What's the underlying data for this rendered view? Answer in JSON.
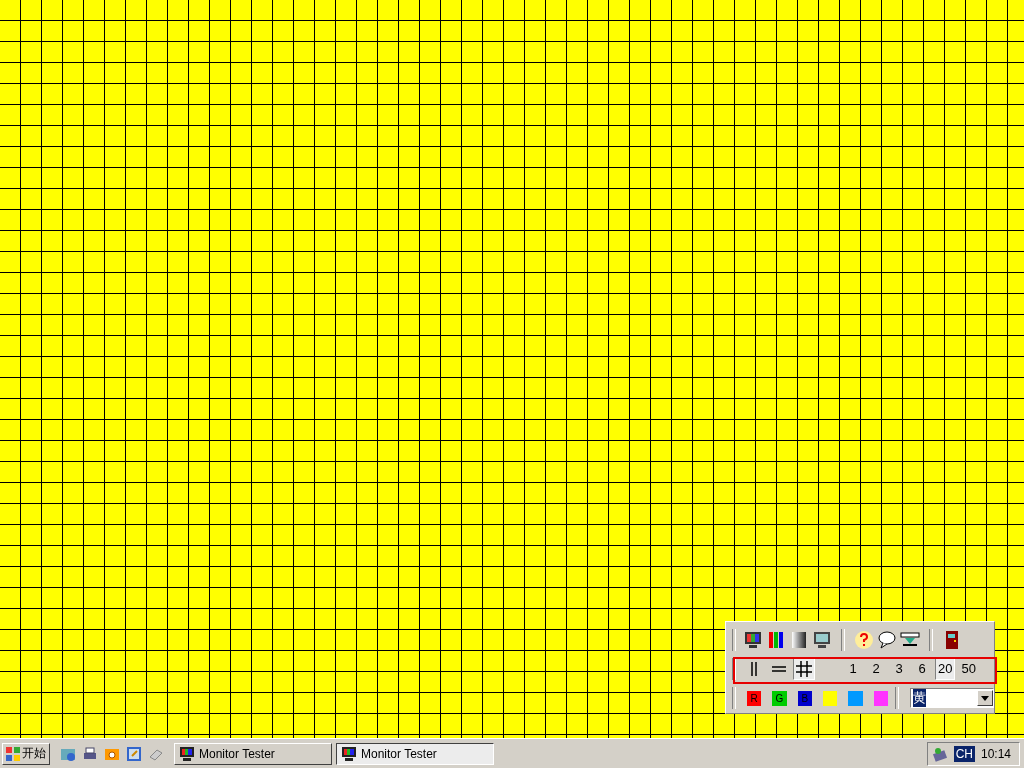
{
  "line_tools": [
    {
      "kind": "vertical",
      "selected": false
    },
    {
      "kind": "horizontal",
      "selected": false
    },
    {
      "kind": "grid",
      "selected": true
    }
  ],
  "spacings": [
    {
      "label": "1",
      "selected": false
    },
    {
      "label": "2",
      "selected": false
    },
    {
      "label": "3",
      "selected": false
    },
    {
      "label": "6",
      "selected": false
    },
    {
      "label": "20",
      "selected": true
    },
    {
      "label": "50",
      "selected": false
    }
  ],
  "swatches": [
    {
      "label": "R",
      "color": "#ff0000"
    },
    {
      "label": "G",
      "color": "#00cc00"
    },
    {
      "label": "B",
      "color": "#0000cc"
    },
    {
      "color": "#ffff00"
    },
    {
      "color": "#0099ff"
    },
    {
      "color": "#ff33ff"
    }
  ],
  "color_select": {
    "value": "黄"
  },
  "taskbar": {
    "start": "开始",
    "tasks": [
      {
        "label": "Monitor Tester",
        "selected": false
      },
      {
        "label": "Monitor Tester",
        "selected": true
      }
    ],
    "language": "CH",
    "clock": "10:14"
  }
}
